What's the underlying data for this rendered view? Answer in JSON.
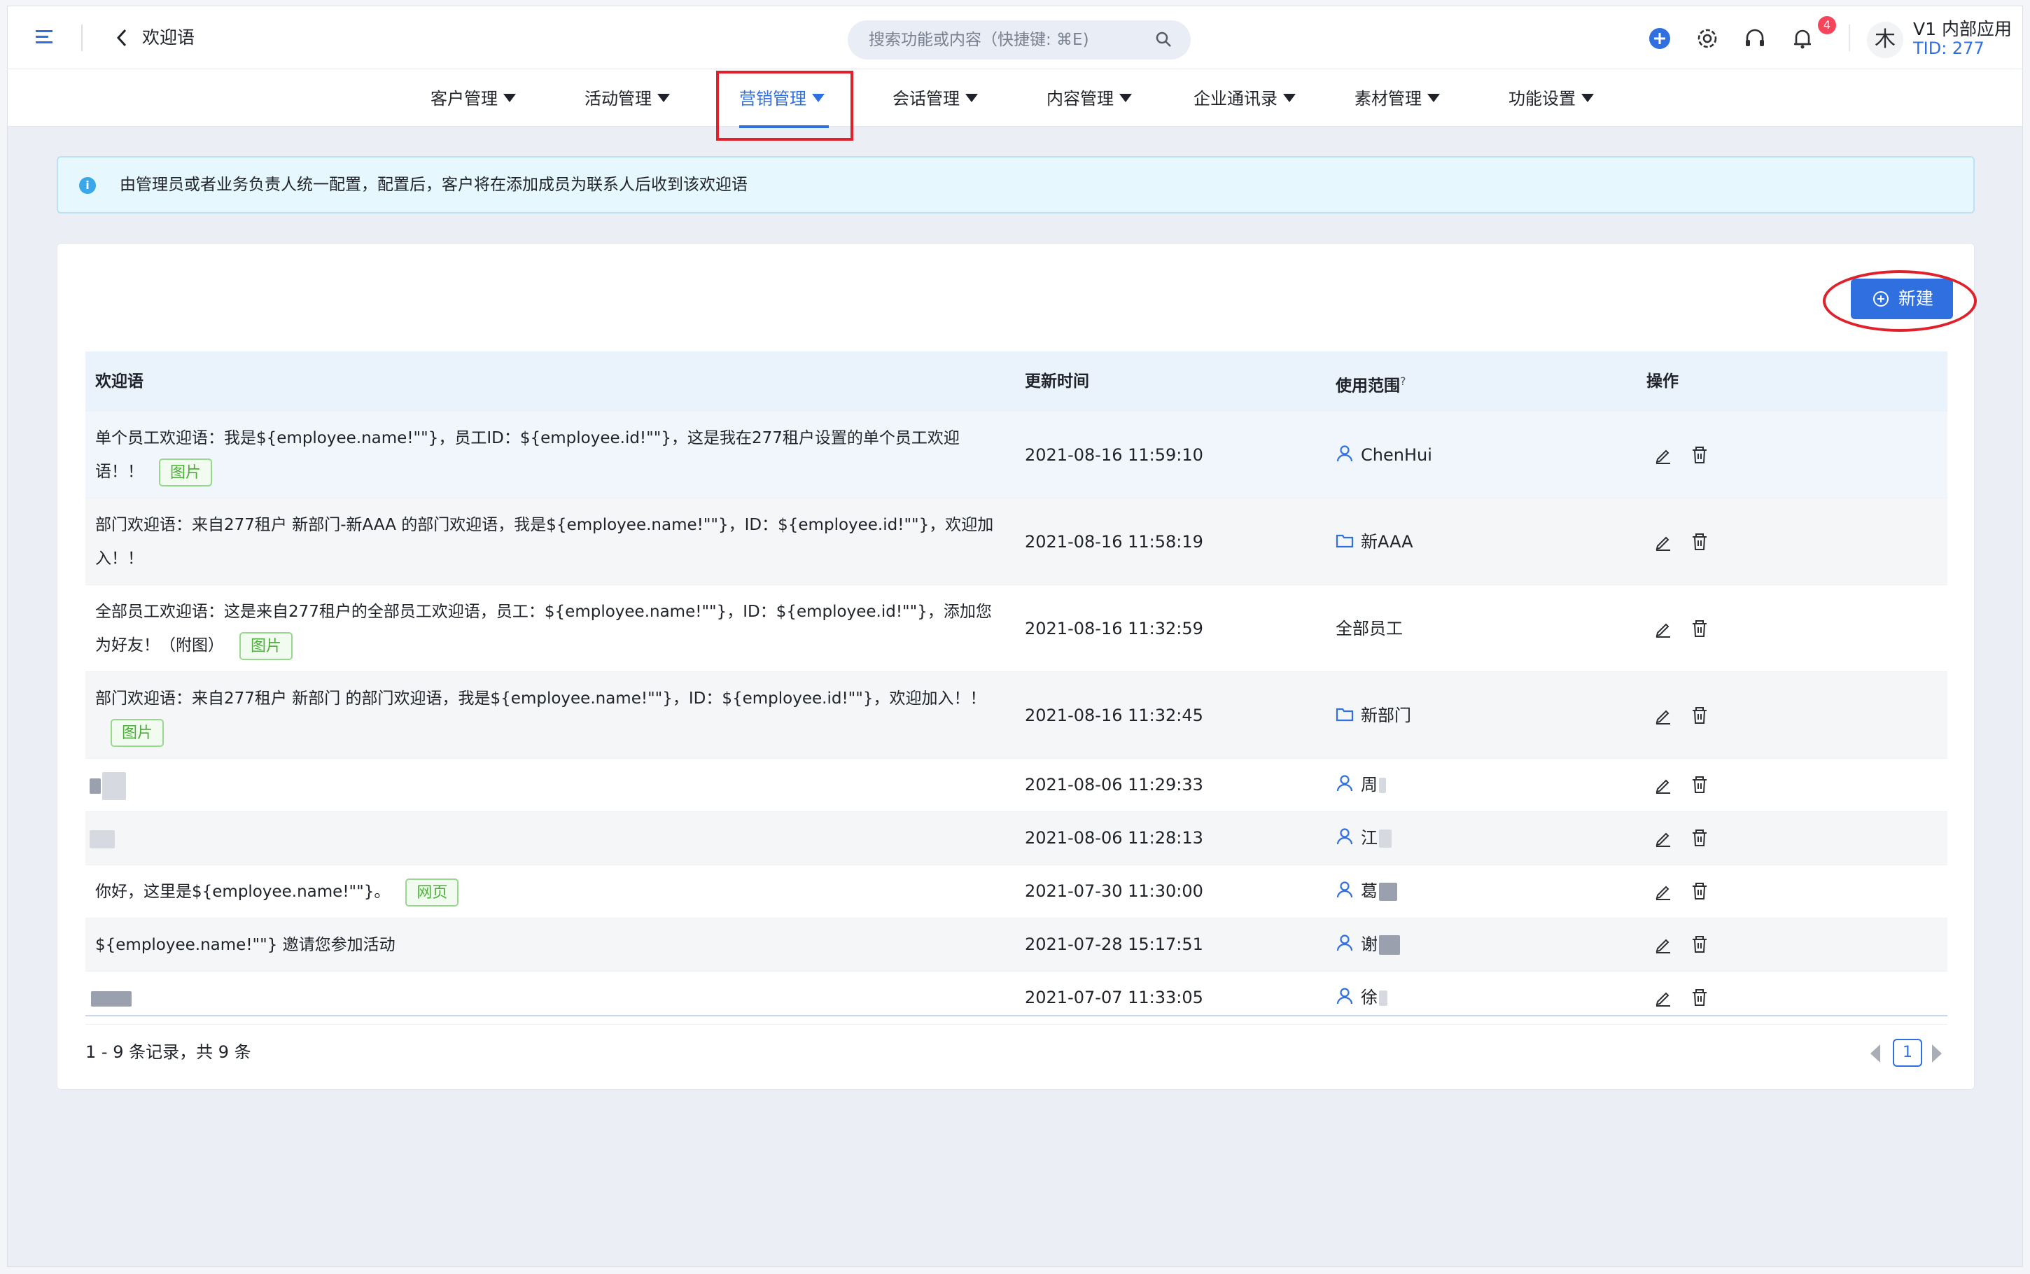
{
  "header": {
    "page_title": "欢迎语",
    "search_placeholder": "搜索功能或内容（快捷键: ⌘E)",
    "notification_count": "4",
    "avatar_char": "木",
    "app_name": "V1 内部应用",
    "tenant_id": "TID: 277"
  },
  "nav": {
    "items": [
      {
        "label": "客户管理"
      },
      {
        "label": "活动管理"
      },
      {
        "label": "营销管理",
        "active": true
      },
      {
        "label": "会话管理"
      },
      {
        "label": "内容管理"
      },
      {
        "label": "企业通讯录"
      },
      {
        "label": "素材管理"
      },
      {
        "label": "功能设置"
      }
    ]
  },
  "notice": {
    "text": "由管理员或者业务负责人统一配置，配置后，客户将在添加成员为联系人后收到该欢迎语"
  },
  "toolbar": {
    "new_label": "新建"
  },
  "table": {
    "columns": [
      "欢迎语",
      "更新时间",
      "使用范围",
      "操作"
    ],
    "scope_help": "?",
    "rows": [
      {
        "message": "单个员工欢迎语：我是${employee.name!\"\"}，员工ID：${employee.id!\"\"}，这是我在277租户设置的单个员工欢迎语！！",
        "tag": "图片",
        "time": "2021-08-16 11:59:10",
        "scope": "ChenHui",
        "scope_icon": "user-icon"
      },
      {
        "message": "部门欢迎语：来自277租户 新部门-新AAA 的部门欢迎语，我是${employee.name!\"\"}，ID：${employee.id!\"\"}，欢迎加入！！",
        "tag": "",
        "time": "2021-08-16 11:58:19",
        "scope": "新AAA",
        "scope_icon": "folder-icon"
      },
      {
        "message": "全部员工欢迎语：这是来自277租户的全部员工欢迎语，员工：${employee.name!\"\"}，ID：${employee.id!\"\"}，添加您为好友！（附图）",
        "tag": "图片",
        "time": "2021-08-16 11:32:59",
        "scope": "全部员工",
        "scope_icon": ""
      },
      {
        "message": "部门欢迎语：来自277租户 新部门 的部门欢迎语，我是${employee.name!\"\"}，ID：${employee.id!\"\"}，欢迎加入！！",
        "tag": "图片",
        "time": "2021-08-16 11:32:45",
        "scope": "新部门",
        "scope_icon": "folder-icon"
      },
      {
        "message": "",
        "tag": "",
        "time": "2021-08-06 11:29:33",
        "scope": "周",
        "scope_icon": "user-icon"
      },
      {
        "message": "",
        "tag": "",
        "time": "2021-08-06 11:28:13",
        "scope": "江",
        "scope_icon": "user-icon"
      },
      {
        "message": "你好，这里是${employee.name!\"\"}。",
        "tag": "网页",
        "time": "2021-07-30 11:30:00",
        "scope": "葛",
        "scope_icon": "user-icon"
      },
      {
        "message": "${employee.name!\"\"} 邀请您参加活动",
        "tag": "",
        "time": "2021-07-28 15:17:51",
        "scope": "谢",
        "scope_icon": "user-icon"
      },
      {
        "message": "",
        "tag": "",
        "time": "2021-07-07 11:33:05",
        "scope": "徐",
        "scope_icon": "user-icon"
      }
    ]
  },
  "pagination": {
    "summary": "1 - 9 条记录，共 9 条",
    "current_page": "1"
  },
  "colors": {
    "accent": "#2f6fdf",
    "highlight_red": "#e0202b",
    "tag_green": "#4cae3a"
  }
}
